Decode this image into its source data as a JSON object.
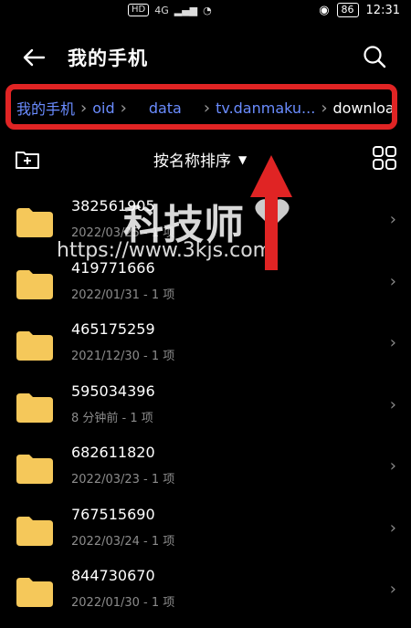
{
  "status": {
    "hd": "HD",
    "net": "4G",
    "battery": "86",
    "time": "12:31"
  },
  "header": {
    "title": "我的手机"
  },
  "breadcrumb": {
    "items": [
      {
        "label": "我的手机"
      },
      {
        "label": "oid"
      },
      {
        "label": "data"
      },
      {
        "label": "tv.danmaku..."
      },
      {
        "label": "download"
      }
    ]
  },
  "toolbar": {
    "sort_label": "按名称排序"
  },
  "folders": [
    {
      "name": "382561905",
      "meta": "2022/03/25 - 1 项"
    },
    {
      "name": "419771666",
      "meta": "2022/01/31 - 1 项"
    },
    {
      "name": "465175259",
      "meta": "2021/12/30 - 1 项"
    },
    {
      "name": "595034396",
      "meta": "8 分钟前 - 1 项"
    },
    {
      "name": "682611820",
      "meta": "2022/03/23 - 1 项"
    },
    {
      "name": "767515690",
      "meta": "2022/03/24 - 1 项"
    },
    {
      "name": "844730670",
      "meta": "2022/01/30 - 1 项"
    }
  ],
  "watermark": {
    "brand": "科技师",
    "url": "https://www.3kjs.com"
  },
  "colors": {
    "accent": "#6a8cff",
    "highlight": "#e02424",
    "folder": "#f5c85a"
  }
}
